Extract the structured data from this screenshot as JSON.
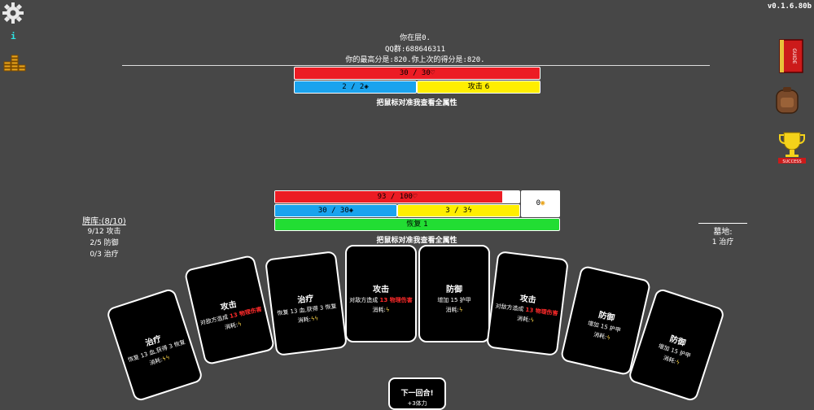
{
  "version": "v0.1.6.80b",
  "colors": {
    "background": "#474747",
    "hp_red": "#ec1c24",
    "shield_blue": "#1aa3ee",
    "energy_yellow": "#ffee00",
    "heal_green": "#22dd33",
    "damage_text": "#ff2a2a",
    "card_bg": "#000000"
  },
  "top_info": {
    "floor_text": "你在层0.",
    "qq_group": "QQ群:688646311",
    "score_text": "你的最高分是:820.你上次的得分是:820."
  },
  "enemy": {
    "hp": "30 / 30",
    "hp_fraction": 1.0,
    "shield": "2 / 2",
    "intent": "攻击 6",
    "hint": "把鼠标对准我查看全属性"
  },
  "player": {
    "hp": "93 / 100",
    "hp_fraction": 0.93,
    "block": "0",
    "shield": "30 / 30",
    "energy": "3 / 3",
    "status": "恢复 1",
    "hint": "把鼠标对准我查看全属性"
  },
  "deck": {
    "title": "牌库:(8/10)",
    "lines": [
      "9/12 攻击",
      "2/5 防御",
      "0/3 治疗"
    ]
  },
  "graveyard": {
    "title": "墓地:",
    "lines": [
      "1 治疗"
    ]
  },
  "hand": [
    {
      "name": "治疗",
      "desc_parts": [
        "恢复 13 血,获得 3 恢复"
      ],
      "cost": "消耗:"
    },
    {
      "name": "攻击",
      "desc_parts": [
        "对敌方造成 ",
        "13",
        " 物理伤害"
      ],
      "cost": "消耗:"
    },
    {
      "name": "治疗",
      "desc_parts": [
        "恢复 13 血,获得 3 恢复"
      ],
      "cost": "消耗:"
    },
    {
      "name": "攻击",
      "desc_parts": [
        "对敌方造成 ",
        "13",
        " 物理伤害"
      ],
      "cost": "消耗:"
    },
    {
      "name": "防御",
      "desc_parts": [
        "增加 15 护甲"
      ],
      "cost": "消耗:"
    },
    {
      "name": "攻击",
      "desc_parts": [
        "对敌方造成 ",
        "13",
        " 物理伤害"
      ],
      "cost": "消耗:"
    },
    {
      "name": "防御",
      "desc_parts": [
        "增加 15 护甲"
      ],
      "cost": "消耗:"
    },
    {
      "name": "防御",
      "desc_parts": [
        "增加 15 护甲"
      ],
      "cost": "消耗:"
    }
  ],
  "next_turn": {
    "label": "下一回合!",
    "sub": "+3体力"
  },
  "icons": {
    "settings": "gear-icon",
    "info": "info-icon",
    "coins": "coin-stack-icon",
    "guide": "guide-book-icon",
    "bag": "backpack-icon",
    "success": "trophy-icon"
  },
  "labels": {
    "guide": "GUIDE",
    "success": "SUCCESS",
    "info": "i"
  }
}
